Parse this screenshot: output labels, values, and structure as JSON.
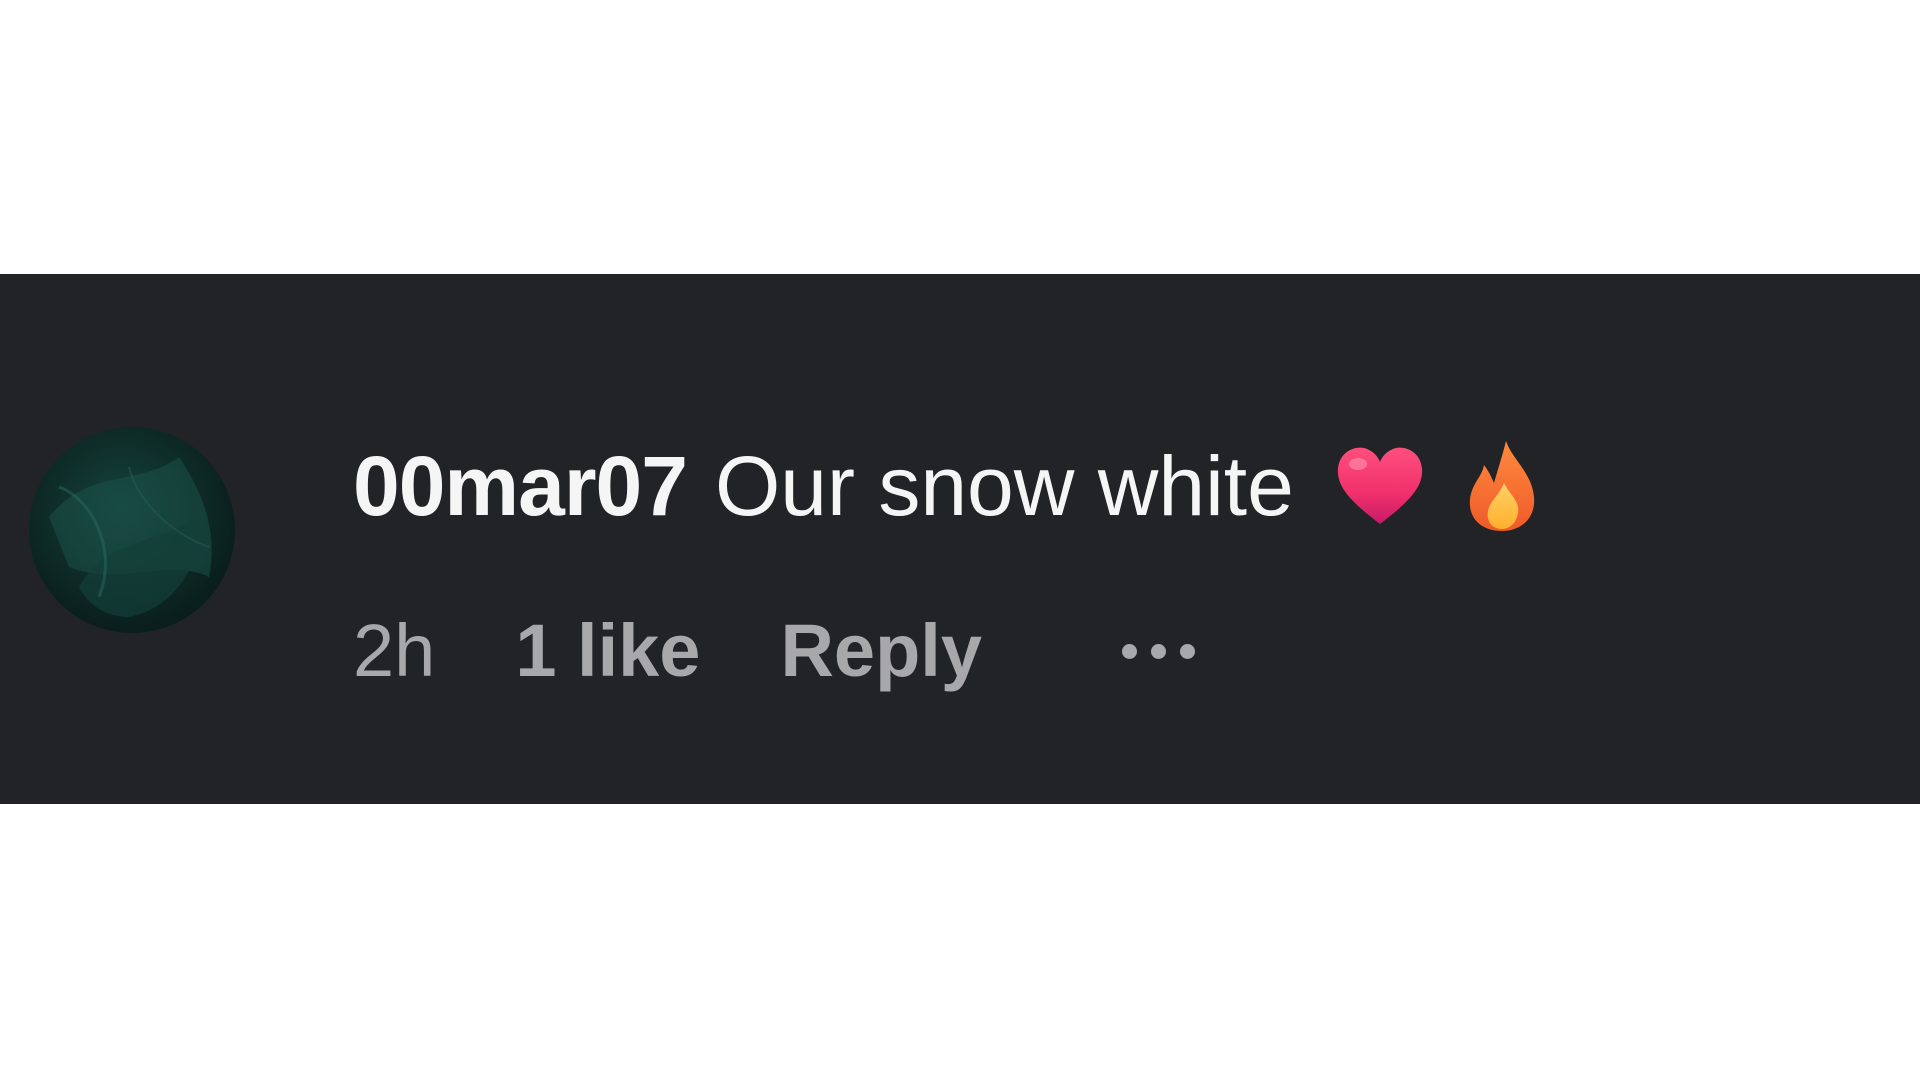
{
  "comment": {
    "username": "00mar07",
    "text": "Our snow white",
    "emojis": [
      "heart-icon",
      "fire-icon"
    ],
    "time": "2h",
    "likes": "1 like",
    "reply_label": "Reply",
    "more_icon": "more-horizontal-icon"
  },
  "colors": {
    "background": "#222327",
    "text_primary": "#f5f5f5",
    "text_secondary": "#a8a8ab",
    "avatar_tint": "#16453f"
  }
}
